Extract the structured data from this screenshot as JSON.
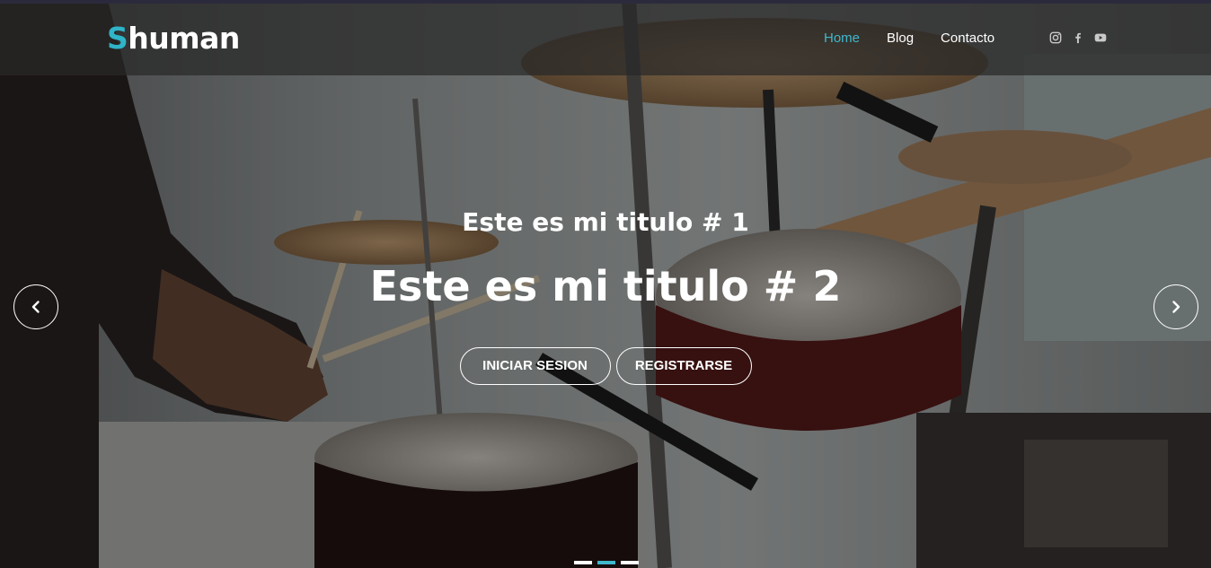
{
  "brand": {
    "accent_letter": "S",
    "rest": "human",
    "accent_color": "#2fb4c8"
  },
  "nav": {
    "items": [
      {
        "label": "Home",
        "active": true
      },
      {
        "label": "Blog",
        "active": false
      },
      {
        "label": "Contacto",
        "active": false
      }
    ]
  },
  "social": {
    "icons": [
      "instagram-icon",
      "facebook-icon",
      "youtube-icon"
    ]
  },
  "slide": {
    "subtitle": "Este es mi titulo # 1",
    "title": "Este es mi titulo # 2",
    "buttons": {
      "login": "INICIAR SESION",
      "register": "REGISTRARSE"
    }
  },
  "carousel": {
    "slide_count": 3,
    "active_index": 1
  },
  "colors": {
    "accent": "#3fb8cc",
    "header_bg": "#282828"
  }
}
